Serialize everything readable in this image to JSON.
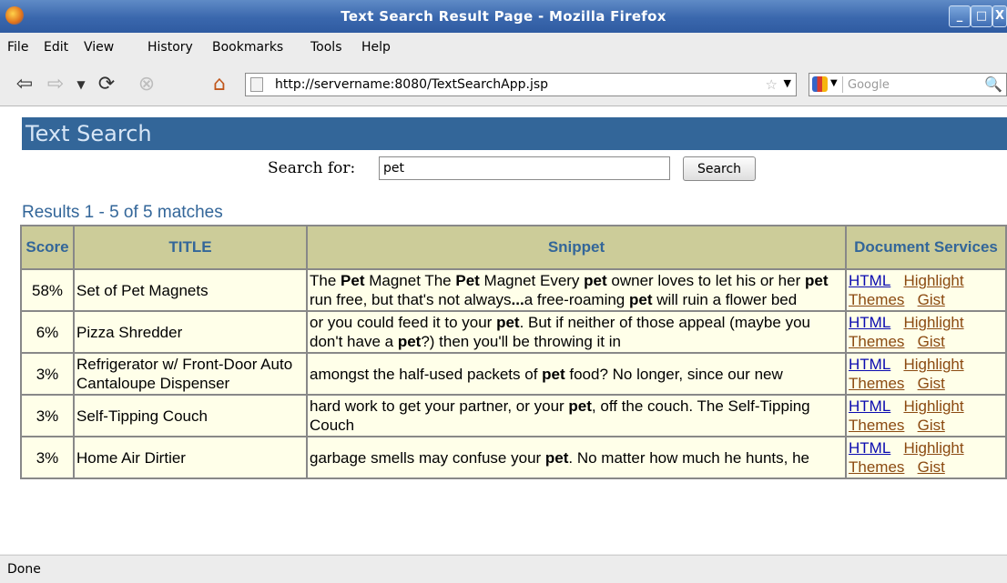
{
  "window": {
    "title": "Text Search Result Page - Mozilla Firefox",
    "buttons": [
      "_",
      "□",
      "X"
    ]
  },
  "menubar": {
    "items": [
      {
        "label": "File"
      },
      {
        "label": "Edit"
      },
      {
        "label": "View"
      },
      {
        "label": "History"
      },
      {
        "label": "Bookmarks"
      },
      {
        "label": "Tools"
      },
      {
        "label": "Help"
      }
    ]
  },
  "navbar": {
    "url": "http://servername:8080/TextSearchApp.jsp",
    "search_placeholder": "Google",
    "icons": [
      "back-icon",
      "forward-icon",
      "history-dropdown-icon",
      "reload-icon",
      "stop-icon",
      "home-icon",
      "bookmark-star-icon",
      "google-icon",
      "magnifier-icon"
    ]
  },
  "page": {
    "header": "Text Search",
    "search_label": "Search for:",
    "search_value": "pet",
    "search_button": "Search",
    "results_summary": "Results 1 - 5 of 5 matches",
    "columns": [
      "Score",
      "TITLE",
      "Snippet",
      "Document Services"
    ],
    "rows": [
      {
        "score": "58%",
        "title": "Set of Pet Magnets",
        "snippet": [
          {
            "t": "The "
          },
          {
            "t": "Pet",
            "b": true
          },
          {
            "t": " Magnet The "
          },
          {
            "t": "Pet",
            "b": true
          },
          {
            "t": " Magnet Every "
          },
          {
            "t": "pet",
            "b": true
          },
          {
            "t": " owner loves to let his or her "
          },
          {
            "t": "pet",
            "b": true
          },
          {
            "t": " run free, but that's not always"
          },
          {
            "t": "...",
            "b": true
          },
          {
            "t": "a free-roaming "
          },
          {
            "t": "pet",
            "b": true
          },
          {
            "t": " will ruin a flower bed"
          }
        ]
      },
      {
        "score": "6%",
        "title": "Pizza Shredder",
        "snippet": [
          {
            "t": "or you could feed it to your "
          },
          {
            "t": "pet",
            "b": true
          },
          {
            "t": ". But if neither of those appeal (maybe you don't have a "
          },
          {
            "t": "pet",
            "b": true
          },
          {
            "t": "?) then you'll be throwing it in"
          }
        ]
      },
      {
        "score": "3%",
        "title": "Refrigerator w/ Front-Door Auto Cantaloupe Dispenser",
        "snippet": [
          {
            "t": "amongst the half-used packets of "
          },
          {
            "t": "pet",
            "b": true
          },
          {
            "t": " food? No longer, since our new"
          }
        ]
      },
      {
        "score": "3%",
        "title": "Self-Tipping Couch",
        "snippet": [
          {
            "t": "hard work to get your partner, or your "
          },
          {
            "t": "pet",
            "b": true
          },
          {
            "t": ", off the couch. The Self-Tipping Couch"
          }
        ]
      },
      {
        "score": "3%",
        "title": "Home Air Dirtier",
        "snippet": [
          {
            "t": "garbage smells may confuse your "
          },
          {
            "t": "pet",
            "b": true
          },
          {
            "t": ". No matter how much he hunts, he"
          }
        ]
      }
    ],
    "services": [
      "HTML",
      "Highlight",
      "Themes",
      "Gist"
    ]
  },
  "status": {
    "text": "Done"
  },
  "colors": {
    "header_bg": "#336699",
    "table_header_bg": "#cccc99",
    "cell_bg": "#ffffe9",
    "link_color": "#8b4a11"
  }
}
